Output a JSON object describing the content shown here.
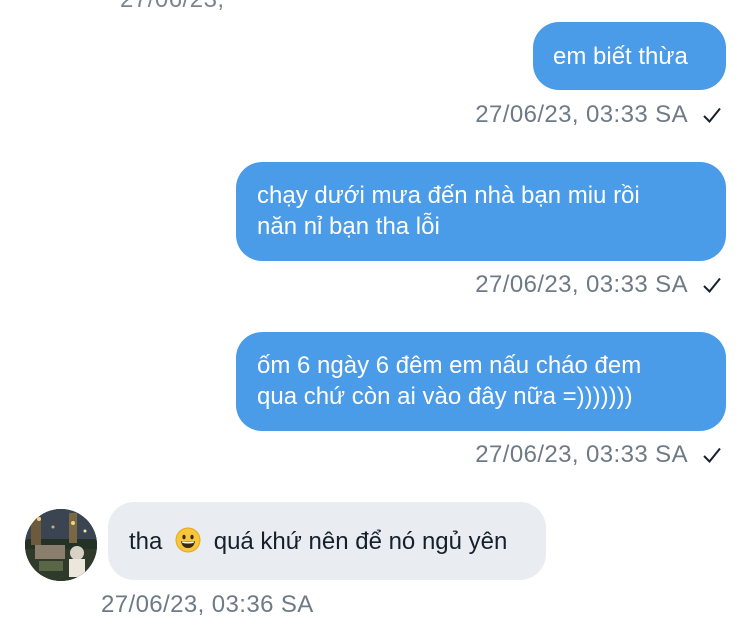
{
  "top_timestamp_fragment": "27/06/23,",
  "messages": [
    {
      "direction": "outgoing",
      "text": "em biết thừa",
      "timestamp": "27/06/23, 03:33 SA",
      "status": "sent-check-icon"
    },
    {
      "direction": "outgoing",
      "lines": [
        "chạy dưới mưa đến nhà bạn miu rồi",
        "năn nỉ bạn tha lỗi"
      ],
      "timestamp": "27/06/23, 03:33 SA",
      "status": "sent-check-icon"
    },
    {
      "direction": "outgoing",
      "lines": [
        "ốm 6 ngày 6 đêm em nấu cháo đem",
        "qua chứ còn ai vào đây nữa =)))))))"
      ],
      "timestamp": "27/06/23, 03:33 SA",
      "status": "sent-check-icon"
    },
    {
      "direction": "incoming",
      "text_before": "tha",
      "emoji": "grinning-face-emoji",
      "text_after": "quá khứ nên để nó ngủ yên",
      "timestamp": "27/06/23, 03:36 SA",
      "avatar": "user-avatar"
    }
  ],
  "colors": {
    "outgoing_bubble": "#4a9be8",
    "incoming_bubble": "#e9edf1",
    "timestamp_text": "#6e7a86"
  }
}
